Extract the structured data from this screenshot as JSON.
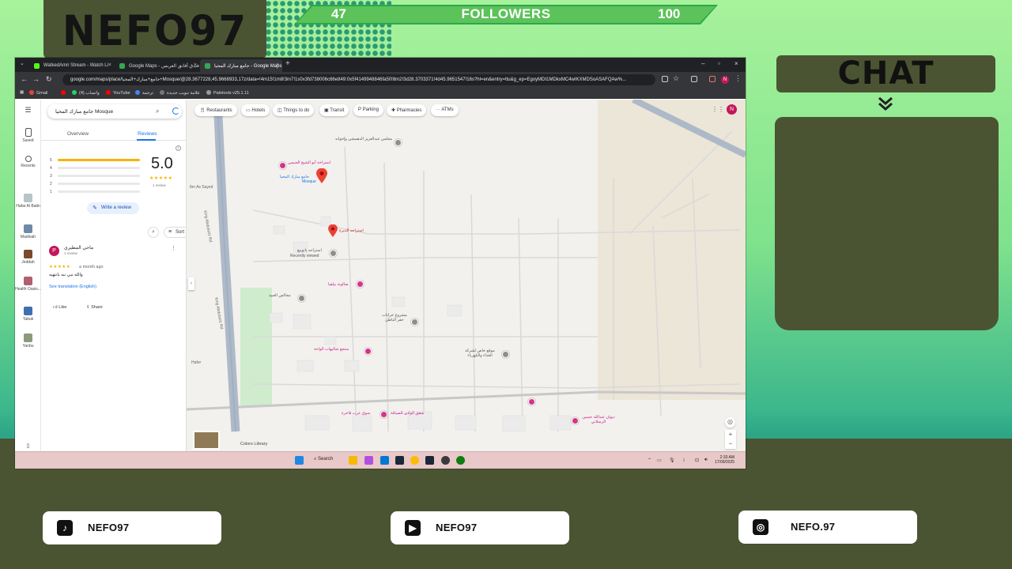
{
  "overlay": {
    "brand": "NEFO97",
    "followers": {
      "current": "47",
      "label": "FOLLOWERS",
      "goal": "100"
    },
    "chat_title": "CHAT",
    "socials": [
      {
        "icon": "tiktok-icon",
        "label": "NEFO97"
      },
      {
        "icon": "youtube-icon",
        "label": "NEFO97"
      },
      {
        "icon": "instagram-icon",
        "label": "NEFO.97"
      }
    ],
    "colors": {
      "green_top": "#a8f29c",
      "teal": "#2fae8c",
      "olive": "#4a5432",
      "bar": "#5cc25a"
    }
  },
  "browser": {
    "tabs": [
      {
        "label": "WatkedAmri Stream - Watch Li",
        "color": "#53fc18"
      },
      {
        "label": "Google Maps - فندق أفانق العربس",
        "color": "#34a853"
      },
      {
        "label": "جامع مبارك المحيا - Google Maps",
        "color": "#34a853",
        "active": true
      }
    ],
    "url": "google.com/maps/place/جامع+مبارك+المحيا+Mosque/@28.3677228,45.9668933,17z/data=!4m15!1m8!3m7!1s0x3fd738006c66e849:0x5f4149948846fa50!8m2!3d28.3703371!4d45.9651547!16s?hl=en&entry=ttu&g_ep=EgoyMDI1MDkxMC4wIKXMDSoASAFQAw%...",
    "bookmarks": [
      "Gmail",
      "",
      "(4) واتساب",
      "YouTube",
      "ترجمة",
      "علامة تبويب جديدة",
      "Paletools v25.1.11"
    ]
  },
  "maps": {
    "rail": [
      "Saved",
      "Recents",
      "Hafar Al Batin",
      "Madinah",
      "Jeddah",
      "Health Oasis...",
      "Tabuk",
      "Yanbu"
    ],
    "search_value": "جامع مبارك المحيا Mosque",
    "tabs": [
      "Overview",
      "Reviews"
    ],
    "distribution": [
      {
        "star": "5",
        "fill": 1.0
      },
      {
        "star": "4",
        "fill": 0
      },
      {
        "star": "3",
        "fill": 0
      },
      {
        "star": "2",
        "fill": 0
      },
      {
        "star": "1",
        "fill": 0
      }
    ],
    "rating": "5.0",
    "stars": "★★★★★",
    "review_count": "1 review",
    "write_review": "Write a review",
    "sort": "Sort",
    "review": {
      "avatar": "P",
      "name": "ماجي المطيري",
      "sub": "1 review",
      "stars": "★★★★★",
      "when": "a month ago",
      "text": "والله نبي نبه بانتهيه",
      "translate": "See translation (English)",
      "like": "Like",
      "share": "Share"
    },
    "chips": [
      "Restaurants",
      "Hotels",
      "Things to do",
      "Transit",
      "Parking",
      "Pharmacies",
      "ATMs"
    ],
    "profile": "N",
    "pois": [
      {
        "label": "مجلس عبدالعزيز الدهمشي وإخوانه",
        "kind": "gray"
      },
      {
        "label": "استراحة أبو الشيخ العنيمي",
        "kind": "pink"
      },
      {
        "label": "جامع مبارك المحيا",
        "kind": "blue"
      },
      {
        "label": "Mosque",
        "kind": "blue"
      },
      {
        "label": "استراحه الديرة",
        "kind": "red"
      },
      {
        "label": "استراحه بانوبيغ",
        "kind": "gray"
      },
      {
        "label": "Recently viewed",
        "kind": "gray"
      },
      {
        "label": "صالونه بيلفيا",
        "kind": "pink"
      },
      {
        "label": "مجالس العبيد",
        "kind": "gray"
      },
      {
        "label": "مشروع خزانات حفر الباطن",
        "kind": "gray"
      },
      {
        "label": "منتجع شاليهات الواحة",
        "kind": "pink"
      },
      {
        "label": "موقع خاص لشركة الغذاء والكهرباء",
        "kind": "gray"
      },
      {
        "label": "شقق الوادي للضيافة",
        "kind": "pink"
      },
      {
        "label": "سوق عرب فاخرة",
        "kind": "pink"
      },
      {
        "label": "ديوان عبدالله حسين الرسلاني",
        "kind": "pink"
      }
    ],
    "roads": [
      "King Abdulaziz Rd",
      "King Abdulaziz Rd",
      "Hafer",
      "Ibn As Sayed"
    ],
    "layers_label": "Colors Library"
  },
  "taskbar": {
    "search": "Search",
    "time": "2:33 AM",
    "date": "17/09/2025"
  }
}
